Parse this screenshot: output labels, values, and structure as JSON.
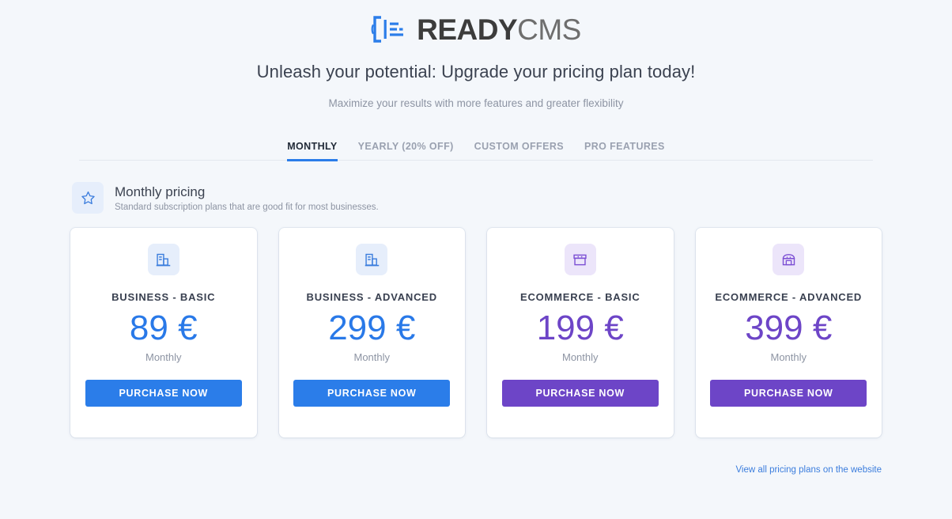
{
  "brand": {
    "logo_icon": "document-bracket-icon",
    "name_bold": "READY",
    "name_light": "CMS",
    "accent_blue": "#2b7de9",
    "accent_purple": "#6d45c7"
  },
  "header": {
    "headline": "Unleash your potential: Upgrade your pricing plan today!",
    "subhead": "Maximize your results with more features and greater flexibility"
  },
  "tabs": [
    {
      "label": "MONTHLY",
      "active": true
    },
    {
      "label": "YEARLY (20% OFF)",
      "active": false
    },
    {
      "label": "CUSTOM OFFERS",
      "active": false
    },
    {
      "label": "PRO FEATURES",
      "active": false
    }
  ],
  "section": {
    "badge_icon": "star-icon",
    "title": "Monthly pricing",
    "subtitle": "Standard subscription plans that are good fit for most businesses."
  },
  "plans": [
    {
      "icon": "office-building-icon",
      "title": "BUSINESS - BASIC",
      "price": "89 €",
      "period": "Monthly",
      "cta": "PURCHASE NOW",
      "color": "#2b7de9"
    },
    {
      "icon": "office-building-icon",
      "title": "BUSINESS - ADVANCED",
      "price": "299 €",
      "period": "Monthly",
      "cta": "PURCHASE NOW",
      "color": "#2b7de9"
    },
    {
      "icon": "storefront-icon",
      "title": "ECOMMERCE - BASIC",
      "price": "199 €",
      "period": "Monthly",
      "cta": "PURCHASE NOW",
      "color": "#6d45c7"
    },
    {
      "icon": "shop-awning-icon",
      "title": "ECOMMERCE - ADVANCED",
      "price": "399 €",
      "period": "Monthly",
      "cta": "PURCHASE NOW",
      "color": "#6d45c7"
    }
  ],
  "footer": {
    "link_label": "View all pricing plans on the website"
  }
}
